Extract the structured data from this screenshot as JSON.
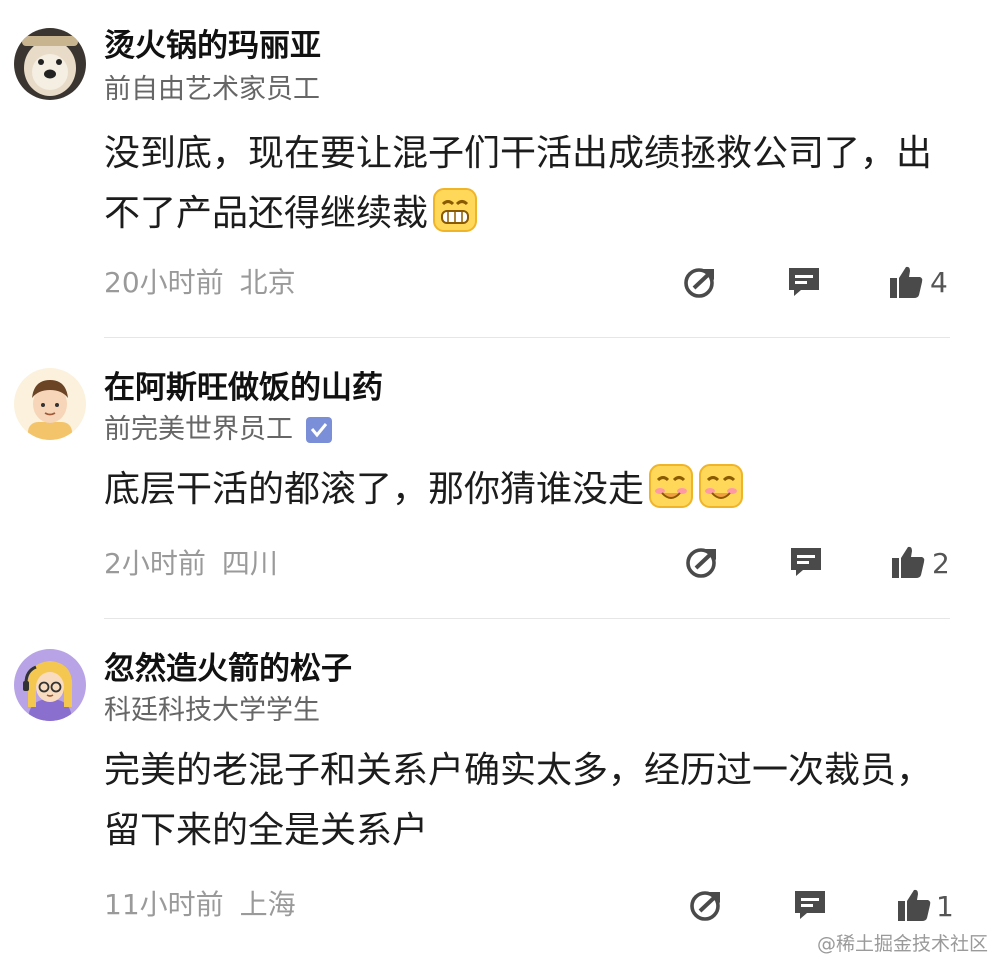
{
  "comments": [
    {
      "username": "烫火锅的玛丽亚",
      "title": "前自由艺术家员工",
      "content": "没到底，现在要让混子们干活出成绩拯救公司了，出不了产品还得继续裁",
      "time": "20小时前",
      "location": "北京",
      "likes": "4"
    },
    {
      "username": "在阿斯旺做饭的山药",
      "title": "前完美世界员工",
      "content": "底层干活的都滚了，那你猜谁没走",
      "time": "2小时前",
      "location": "四川",
      "likes": "2"
    },
    {
      "username": "忽然造火箭的松子",
      "title": "科廷科技大学学生",
      "content": "完美的老混子和关系户确实太多，经历过一次裁员，留下来的全是关系户",
      "time": "11小时前",
      "location": "上海",
      "likes": "1"
    }
  ],
  "watermark": "@稀土掘金技术社区",
  "colors": {
    "icon": "#4a4a4a",
    "meta_text": "#9a9a9a",
    "verified": "#7a8fd8"
  },
  "icons": [
    "share-icon",
    "reply-icon",
    "like-icon",
    "verified-icon",
    "grin-emoji",
    "blush-emoji"
  ]
}
